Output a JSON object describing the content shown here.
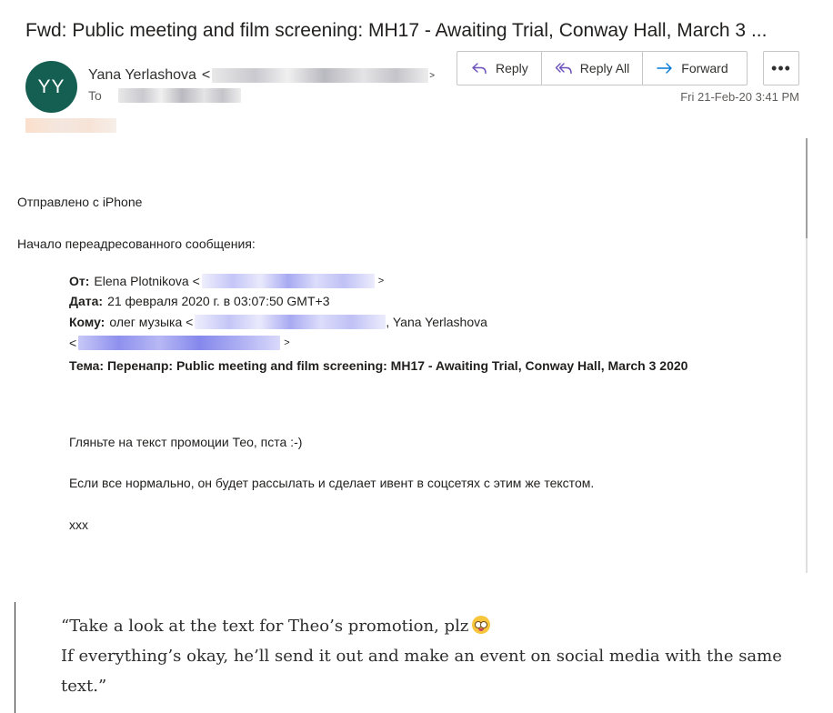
{
  "email": {
    "subject": "Fwd: Public meeting and film screening: MH17 - Awaiting Trial, Conway Hall, March 3 ...",
    "avatar_initials": "YY",
    "avatar_color": "#155f52",
    "sender_name": "Yana Yerlashova",
    "sender_open": "<",
    "sender_close": ">",
    "to_label": "To",
    "datetime": "Fri 21-Feb-20 3:41 PM"
  },
  "toolbar": {
    "reply_label": "Reply",
    "reply_all_label": "Reply All",
    "forward_label": "Forward",
    "more_label": "•••",
    "accent_color": "#6b4fbb",
    "forward_color": "#0078d4"
  },
  "body": {
    "sent_from": "Отправлено с iPhone",
    "forwarded_intro": "Начало переадресованного сообщения:",
    "from_label": "От:",
    "from_value": "Elena Plotnikova <",
    "from_close": ">",
    "date_label": "Дата:",
    "date_value": "21 февраля 2020 г. в 03:07:50 GMT+3",
    "to_label": "Кому:",
    "to_value": "олег музыка <",
    "to_second": ", Yana Yerlashova",
    "to_third_open": "<",
    "to_third_close": ">",
    "subject_label": "Тема:",
    "subject_value": "Перенапр:  Public meeting and film screening: MH17 - Awaiting Trial, Conway Hall, March 3 2020",
    "line1": "Гляньте на текст промоции Тео, пста :-)",
    "line2": "Если все нормально, он будет рассылать и сделает ивент в соцсетях с этим же текстом.",
    "signoff": "xxx"
  },
  "quote": {
    "line1": "“Take a look at the text for Theo’s promotion, plz",
    "line2": "If everything’s okay, he’ll send it out and make an event on social media with the same text.”"
  }
}
